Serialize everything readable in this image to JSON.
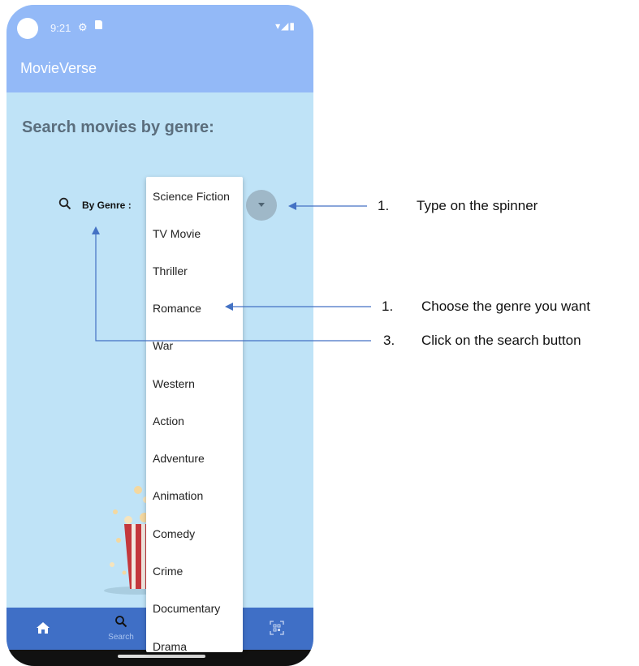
{
  "status_bar": {
    "time": "9:21",
    "gear_icon": "settings-gear-icon",
    "sd_icon": "sd-card-icon",
    "right_icons": "▾◢▮"
  },
  "app": {
    "title": "MovieVerse"
  },
  "search": {
    "heading": "Search movies by genre:",
    "label": "By Genre :"
  },
  "spinner": {
    "options": [
      "Science Fiction",
      "TV Movie",
      "Thriller",
      "Romance",
      "War",
      "Western",
      "Action",
      "Adventure",
      "Animation",
      "Comedy",
      "Crime",
      "Documentary",
      "Drama"
    ]
  },
  "bottom_nav": {
    "home_icon": "home-icon",
    "search_label": "Search",
    "qr_icon": "qr-scan-icon"
  },
  "annotations": {
    "step1_num": "1.",
    "step1_text": "Type on the spinner",
    "step2_num": "1.",
    "step2_text": "Choose the genre you want",
    "step3_num": "3.",
    "step3_text": "Click on the search button"
  },
  "colors": {
    "appbar": "#93b9f7",
    "background": "#bfe3f7",
    "bottom_nav": "#3f6fc6",
    "arrow": "#4472c4"
  }
}
